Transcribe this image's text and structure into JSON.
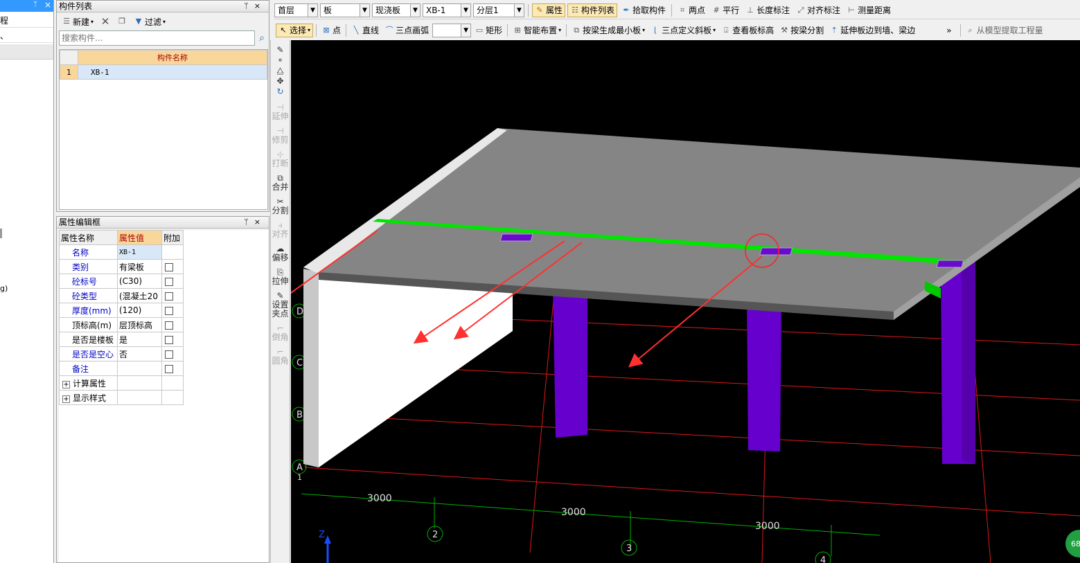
{
  "left_strip": {
    "pin": "ᛘ",
    "close": "×",
    "labels": [
      "程",
      "、",
      "g)"
    ]
  },
  "component_list": {
    "title": "构件列表",
    "new_label": "新建",
    "filter_label": "过滤",
    "search_placeholder": "搜索构件...",
    "column_header": "构件名称",
    "rows": [
      {
        "index": "1",
        "name": "XB-1"
      }
    ]
  },
  "property_editor": {
    "title": "属性编辑框",
    "headers": [
      "属性名称",
      "属性值",
      "附加"
    ],
    "rows": [
      {
        "name": "名称",
        "value": "XB-1",
        "blue": true
      },
      {
        "name": "类别",
        "value": "有梁板",
        "blue": true
      },
      {
        "name": "砼标号",
        "value": "(C30)",
        "blue": true
      },
      {
        "name": "砼类型",
        "value": "(混凝土20",
        "blue": true
      },
      {
        "name": "厚度(mm)",
        "value": "(120)",
        "blue": true
      },
      {
        "name": "顶标高(m)",
        "value": "层顶标高",
        "blue": false
      },
      {
        "name": "是否是楼板",
        "value": "是",
        "blue": false
      },
      {
        "name": "是否是空心",
        "value": "否",
        "blue": true
      },
      {
        "name": "备注",
        "value": "",
        "blue": true
      }
    ],
    "groups": [
      "计算属性",
      "显示样式"
    ]
  },
  "toolbar1": {
    "floor": "首层",
    "category": "板",
    "type": "现浇板",
    "component": "XB-1",
    "sublayer": "分层1",
    "buttons": [
      "属性",
      "构件列表",
      "拾取构件",
      "两点",
      "平行",
      "长度标注",
      "对齐标注",
      "测量距离"
    ]
  },
  "toolbar2": {
    "buttons": [
      "选择",
      "点",
      "直线",
      "三点画弧",
      "矩形",
      "智能布置",
      "按梁生成最小板",
      "三点定义斜板",
      "查看板标高",
      "按梁分割",
      "延伸板边到墙、梁边"
    ],
    "more": "»",
    "extract": "从模型提取工程量"
  },
  "vertical_toolbar": [
    "延伸",
    "修剪",
    "打断",
    "合并",
    "分割",
    "对齐",
    "偏移",
    "拉伸",
    "设置夹点",
    "倒角",
    "圆角"
  ],
  "viewport": {
    "axis_letters": [
      "D",
      "C",
      "B",
      "A"
    ],
    "axis_numbers": [
      "1",
      "2",
      "3",
      "4"
    ],
    "dimensions": [
      "3000",
      "3000",
      "3000"
    ],
    "z_label": "Z",
    "badge": "68",
    "colors": {
      "slab": "#858585",
      "beam": "#00e600",
      "column": "#6600cc",
      "grid": "#ff2020",
      "dim": "#00cc00"
    }
  }
}
